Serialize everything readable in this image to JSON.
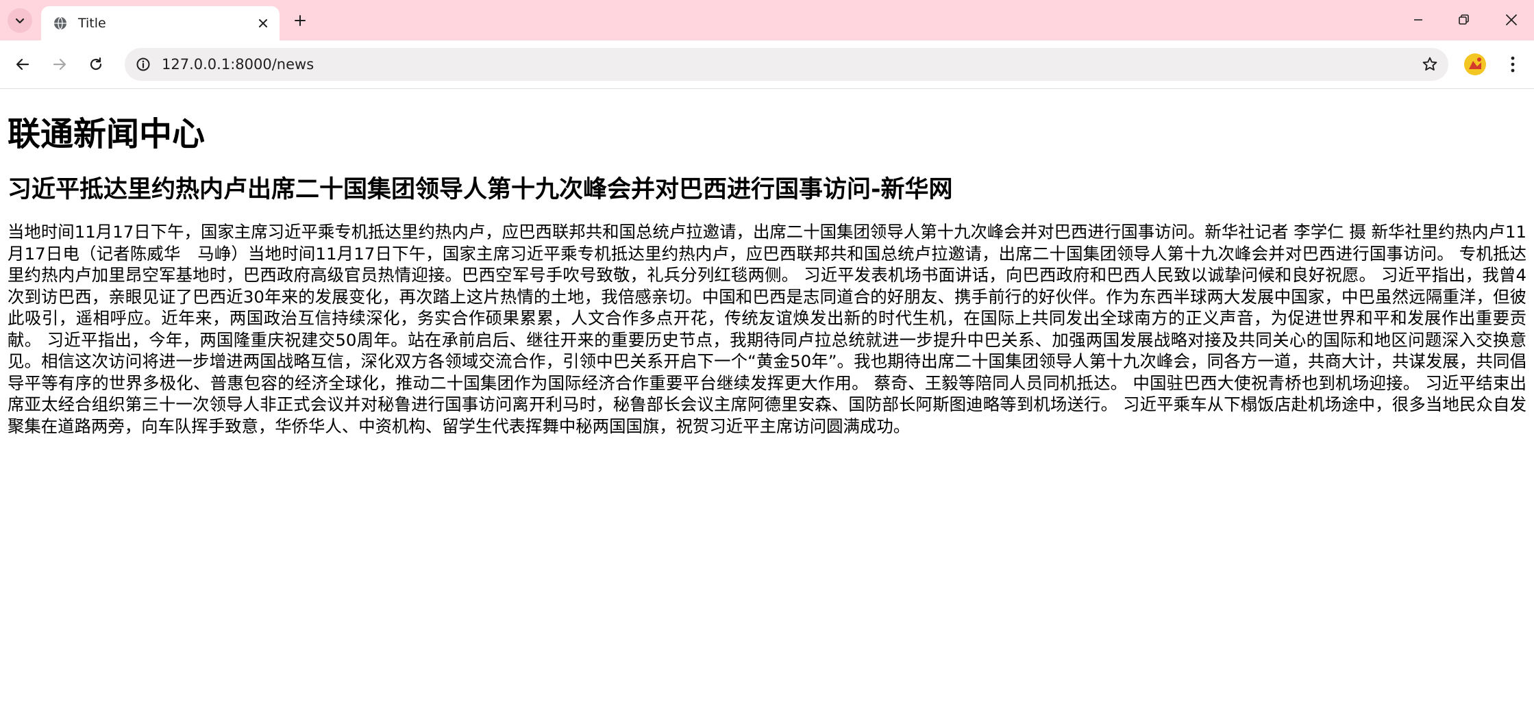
{
  "browser": {
    "tab": {
      "title": "Title",
      "favicon_icon": "globe-icon"
    },
    "address_bar": {
      "url": "127.0.0.1:8000/news"
    },
    "icons": {
      "tab_search": "chevron-down-icon",
      "tab_close": "close-icon",
      "new_tab": "plus-icon",
      "minimize": "minimize-icon",
      "restore": "restore-icon",
      "close_window": "close-icon",
      "back": "arrow-left-icon",
      "forward": "arrow-right-icon",
      "reload": "reload-icon",
      "site_info": "info-icon",
      "bookmark": "star-icon",
      "profile": "profile-avatar-icon",
      "menu": "kebab-menu-icon"
    },
    "colors": {
      "tabstrip_bg": "#ffd6de",
      "omnibox_bg": "#f1eeef"
    }
  },
  "page": {
    "heading": "联通新闻中心",
    "article": {
      "title": "习近平抵达里约热内卢出席二十国集团领导人第十九次峰会并对巴西进行国事访问-新华网",
      "body": "当地时间11月17日下午，国家主席习近平乘专机抵达里约热内卢，应巴西联邦共和国总统卢拉邀请，出席二十国集团领导人第十九次峰会并对巴西进行国事访问。新华社记者 李学仁 摄 新华社里约热内卢11月17日电（记者陈威华　马峥）当地时间11月17日下午，国家主席习近平乘专机抵达里约热内卢，应巴西联邦共和国总统卢拉邀请，出席二十国集团领导人第十九次峰会并对巴西进行国事访问。 专机抵达里约热内卢加里昂空军基地时，巴西政府高级官员热情迎接。巴西空军号手吹号致敬，礼兵分列红毯两侧。 习近平发表机场书面讲话，向巴西政府和巴西人民致以诚挚问候和良好祝愿。 习近平指出，我曾4次到访巴西，亲眼见证了巴西近30年来的发展变化，再次踏上这片热情的土地，我倍感亲切。中国和巴西是志同道合的好朋友、携手前行的好伙伴。作为东西半球两大发展中国家，中巴虽然远隔重洋，但彼此吸引，遥相呼应。近年来，两国政治互信持续深化，务实合作硕果累累，人文合作多点开花，传统友谊焕发出新的时代生机，在国际上共同发出全球南方的正义声音，为促进世界和平和发展作出重要贡献。 习近平指出，今年，两国隆重庆祝建交50周年。站在承前启后、继往开来的重要历史节点，我期待同卢拉总统就进一步提升中巴关系、加强两国发展战略对接及共同关心的国际和地区问题深入交换意见。相信这次访问将进一步增进两国战略互信，深化双方各领域交流合作，引领中巴关系开启下一个“黄金50年”。我也期待出席二十国集团领导人第十九次峰会，同各方一道，共商大计，共谋发展，共同倡导平等有序的世界多极化、普惠包容的经济全球化，推动二十国集团作为国际经济合作重要平台继续发挥更大作用。 蔡奇、王毅等陪同人员同机抵达。 中国驻巴西大使祝青桥也到机场迎接。 习近平结束出席亚太经合组织第三十一次领导人非正式会议并对秘鲁进行国事访问离开利马时，秘鲁部长会议主席阿德里安森、国防部长阿斯图迪略等到机场送行。 习近平乘车从下榻饭店赴机场途中，很多当地民众自发聚集在道路两旁，向车队挥手致意，华侨华人、中资机构、留学生代表挥舞中秘两国国旗，祝贺习近平主席访问圆满成功。"
    }
  }
}
